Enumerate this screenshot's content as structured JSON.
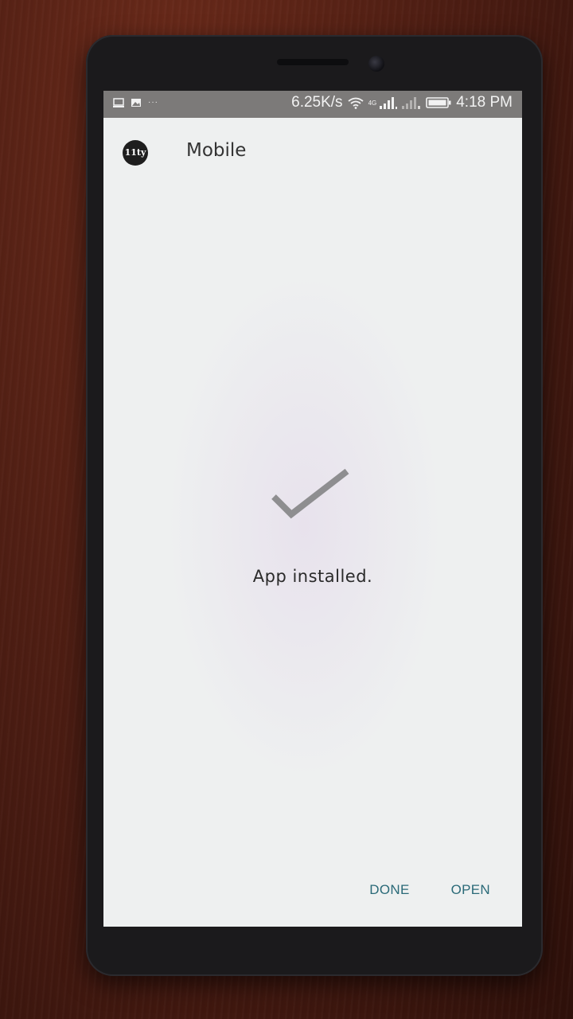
{
  "status_bar": {
    "net_speed": "6.25K/s",
    "network_type": "4G",
    "time": "4:18 PM",
    "dots": "···",
    "icons": [
      "screen-icon",
      "image-icon",
      "wifi-icon",
      "signal-icon",
      "signal-sim2-icon",
      "battery-icon"
    ]
  },
  "app_bar": {
    "logo_text": "11ty",
    "title": "Mobile"
  },
  "main": {
    "message": "App installed."
  },
  "actions": {
    "done_label": "DONE",
    "open_label": "OPEN"
  },
  "colors": {
    "accent": "#2a6a78",
    "check": "#8e8e90",
    "status_bar_bg": "#7c7a79",
    "screen_bg": "#eef0f0"
  }
}
